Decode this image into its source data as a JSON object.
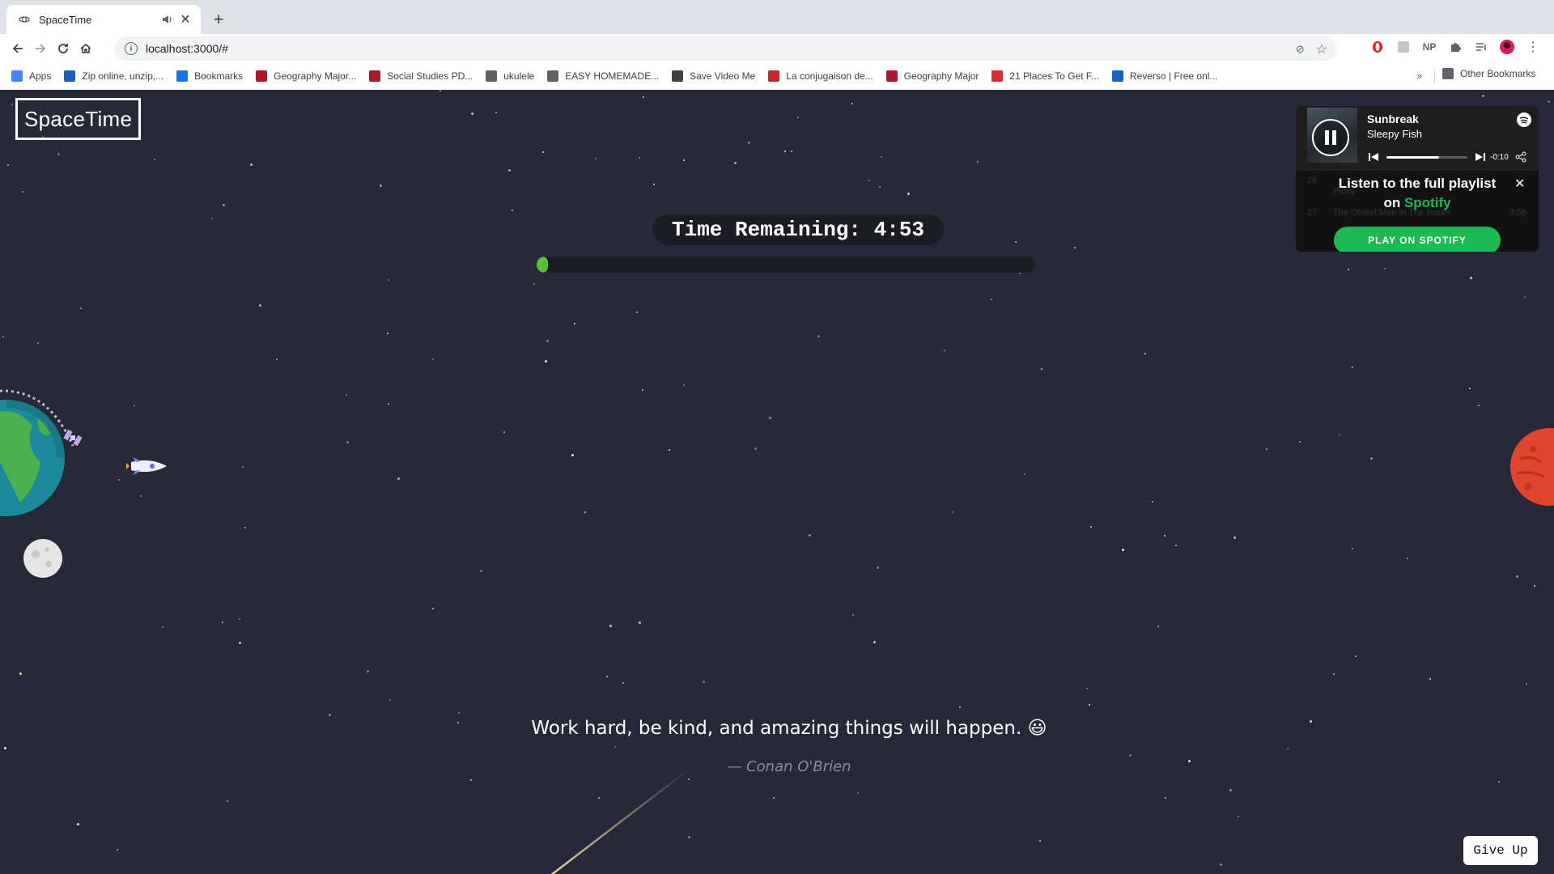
{
  "browser": {
    "tab": {
      "title": "SpaceTime"
    },
    "address_bar": {
      "url": "localhost:3000/#"
    },
    "bookmarks": [
      {
        "label": "Apps",
        "icon": "apps-grid-icon",
        "color": "#4285f4"
      },
      {
        "label": "Zip online, unzip,...",
        "icon": "b1-icon",
        "color": "#1a5fb4"
      },
      {
        "label": "Bookmarks",
        "icon": "star-icon",
        "color": "#1a73e8"
      },
      {
        "label": "Geography Major...",
        "icon": "sfu-icon",
        "color": "#a6192e"
      },
      {
        "label": "Social Studies PD...",
        "icon": "sfu-icon",
        "color": "#a6192e"
      },
      {
        "label": "ukulele",
        "icon": "folder-icon",
        "color": "#5f6368"
      },
      {
        "label": "EASY HOMEMADE...",
        "icon": "folder-outline-icon",
        "color": "#5f6368"
      },
      {
        "label": "Save Video Me",
        "icon": "globe-icon",
        "color": "#3c4043"
      },
      {
        "label": "La conjugaison de...",
        "icon": "conj-icon",
        "color": "#c62828"
      },
      {
        "label": "Geography Major",
        "icon": "sfu-icon",
        "color": "#a6192e"
      },
      {
        "label": "21 Places To Get F...",
        "icon": "g-icon",
        "color": "#d32f2f"
      },
      {
        "label": "Reverso | Free onl...",
        "icon": "reverso-icon",
        "color": "#1565c0"
      }
    ],
    "bookmarks_more": "»",
    "other_bookmarks": "Other Bookmarks"
  },
  "app": {
    "logo": "SpaceTime",
    "timer_text": "Time Remaining: 4:53",
    "progress_fraction": 0.02,
    "quote": "Work hard, be kind, and amazing things will happen. 😃",
    "author": "— Conan O'Brien",
    "give_up_label": "Give Up",
    "colors": {
      "background": "#272838",
      "progress": "#5cbf3a",
      "spotify_green": "#1db954"
    }
  },
  "spotify": {
    "song": "Sunbreak",
    "artist": "Sleepy Fish",
    "time": "-0:10",
    "playback_fraction": 0.65,
    "cta_line1": "Listen to the full playlist",
    "cta_on": "on",
    "cta_brand": "Spotify",
    "button": "PLAY ON SPOTIFY",
    "ghost_num1": "26",
    "ghost_title1": "Plony",
    "ghost_num2": "27",
    "ghost_title2": "The Oldest Man In The Room",
    "ghost_dur2": "3:56"
  }
}
